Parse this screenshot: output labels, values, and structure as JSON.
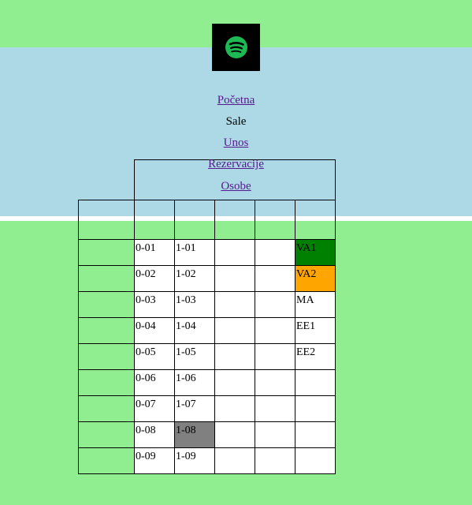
{
  "header": {
    "logo_icon": "spotify-logo-icon",
    "logo_color": "#1db954"
  },
  "nav": {
    "home": "Početna",
    "halls": "Sale",
    "entry": "Unos",
    "reservations": "Rezervacije",
    "people": "Osobe"
  },
  "grid": {
    "column_0": [
      "0-01",
      "0-02",
      "0-03",
      "0-04",
      "0-05",
      "0-06",
      "0-07",
      "0-08",
      "0-09"
    ],
    "column_1": [
      "1-01",
      "1-02",
      "1-03",
      "1-04",
      "1-05",
      "1-06",
      "1-07",
      "1-08",
      "1-09"
    ],
    "column_4": [
      "VA1",
      "VA2",
      "MA",
      "EE1",
      "EE2"
    ],
    "highlight_colors": {
      "VA1": "#008000",
      "VA2": "#ffa500",
      "1-08": "#808080"
    }
  }
}
